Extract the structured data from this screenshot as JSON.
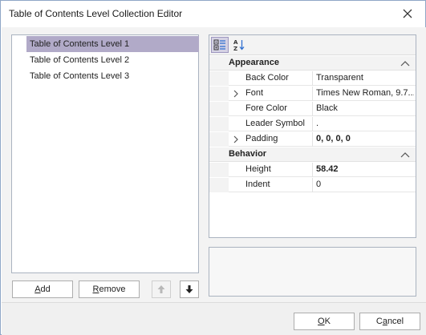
{
  "window": {
    "title": "Table of Contents Level Collection Editor"
  },
  "list": {
    "items": [
      {
        "label": "Table of Contents Level 1",
        "selected": true
      },
      {
        "label": "Table of Contents Level 2",
        "selected": false
      },
      {
        "label": "Table of Contents Level 3",
        "selected": false
      }
    ],
    "buttons": {
      "add_mnemonic": "A",
      "add_rest": "dd",
      "remove_mnemonic": "R",
      "remove_rest": "emove",
      "move_up_enabled": false,
      "move_down_enabled": true
    }
  },
  "property_grid": {
    "toolbar": {
      "categorized_active": true,
      "alphabetical_active": false
    },
    "categories": [
      {
        "name": "Appearance",
        "properties": [
          {
            "name": "Back Color",
            "value": "Transparent",
            "expandable": false,
            "bold": false
          },
          {
            "name": "Font",
            "value": "Times New Roman, 9.7...",
            "expandable": true,
            "bold": false
          },
          {
            "name": "Fore Color",
            "value": "Black",
            "expandable": false,
            "bold": false
          },
          {
            "name": "Leader Symbol",
            "value": ".",
            "expandable": false,
            "bold": false
          },
          {
            "name": "Padding",
            "value": "0, 0, 0, 0",
            "expandable": true,
            "bold": true
          }
        ]
      },
      {
        "name": "Behavior",
        "properties": [
          {
            "name": "Height",
            "value": "58.42",
            "expandable": false,
            "bold": true
          },
          {
            "name": "Indent",
            "value": "0",
            "expandable": false,
            "bold": false
          }
        ]
      }
    ]
  },
  "footer": {
    "ok_mnemonic": "O",
    "ok_rest": "K",
    "cancel_pre": "C",
    "cancel_mnemonic": "a",
    "cancel_rest": "ncel"
  },
  "colors": {
    "selection": "#b1aac8",
    "border": "#aab3c0",
    "toolbar_active": "#d5d2e4"
  },
  "icons": {
    "close": "close-icon",
    "categorized": "categorized-icon",
    "alphabetical": "sort-alphabetical-icon",
    "arrow_up": "arrow-up-icon",
    "arrow_down": "arrow-down-icon",
    "chevron_up": "chevron-up-icon",
    "chevron_right": "chevron-right-icon"
  }
}
